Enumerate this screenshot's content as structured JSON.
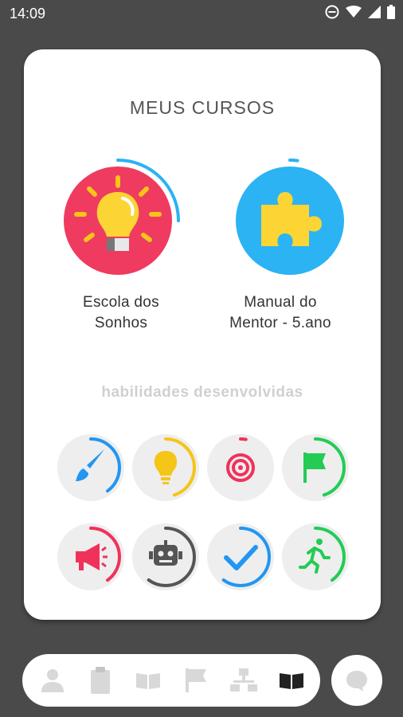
{
  "status_bar": {
    "time": "14:09"
  },
  "card": {
    "title": "MEUS CURSOS"
  },
  "courses": [
    {
      "line1": "Escola dos",
      "line2": "Sonhos",
      "color": "#ef3b5f",
      "icon": "lightbulb-icon",
      "progress": 0.25
    },
    {
      "line1": "Manual do",
      "line2": "Mentor - 5.ano",
      "color": "#2bb3f4",
      "icon": "puzzle-icon",
      "progress": 0.02
    }
  ],
  "skills_title": "habilidades desenvolvidas",
  "skills": [
    {
      "icon": "paintbrush-icon",
      "color": "#2196f3",
      "progress": 0.4
    },
    {
      "icon": "lightbulb-icon",
      "color": "#f5c518",
      "progress": 0.45
    },
    {
      "icon": "target-icon",
      "color": "#f0325a",
      "progress": 0.03
    },
    {
      "icon": "flag-icon",
      "color": "#22cc55",
      "progress": 0.45
    },
    {
      "icon": "megaphone-icon",
      "color": "#f0325a",
      "progress": 0.4
    },
    {
      "icon": "robot-icon",
      "color": "#555555",
      "progress": 0.6
    },
    {
      "icon": "checkmark-icon",
      "color": "#2196f3",
      "progress": 0.6
    },
    {
      "icon": "running-person-icon",
      "color": "#22cc55",
      "progress": 0.4
    }
  ],
  "bottom_nav": [
    {
      "icon": "person-icon",
      "active": false
    },
    {
      "icon": "clipboard-icon",
      "active": false
    },
    {
      "icon": "open-book-icon",
      "active": false
    },
    {
      "icon": "flag-icon",
      "active": false
    },
    {
      "icon": "network-icon",
      "active": false
    },
    {
      "icon": "book-icon",
      "active": true
    }
  ],
  "chat_button": {
    "icon": "chat-bubble-icon"
  }
}
